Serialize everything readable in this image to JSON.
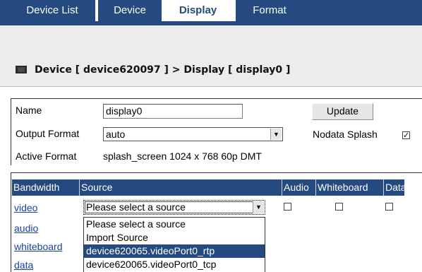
{
  "tabs": [
    {
      "label": "Device List",
      "active": false
    },
    {
      "label": "Device",
      "active": false
    },
    {
      "label": "Display",
      "active": true
    },
    {
      "label": "Format",
      "active": false
    }
  ],
  "breadcrumb": {
    "icon": "display-icon",
    "text": "Device [ device620097 ] > Display [ display0 ]"
  },
  "form": {
    "name_label": "Name",
    "name_value": "display0",
    "update_label": "Update",
    "output_format_label": "Output Format",
    "output_format_value": "auto",
    "nodata_splash_label": "Nodata Splash",
    "nodata_splash_checked": true,
    "active_format_label": "Active Format",
    "active_format_value": "splash_screen 1024 x 768 60p DMT"
  },
  "table": {
    "headers": [
      "Bandwidth",
      "Source",
      "Audio",
      "Whiteboard",
      "Data"
    ],
    "rows": [
      {
        "bandwidth": "video"
      },
      {
        "bandwidth": "audio"
      },
      {
        "bandwidth": "whiteboard"
      },
      {
        "bandwidth": "data"
      }
    ],
    "source_select_value": "Please select a source",
    "source_options": [
      "Please select a source",
      "Import Source",
      "device620065.videoPort0_rtp",
      "device620065.videoPort0_tcp"
    ],
    "highlighted_option_index": 2
  },
  "colors": {
    "accent": "#254a7f",
    "link": "#1a3fa6",
    "band": "#ececec"
  }
}
